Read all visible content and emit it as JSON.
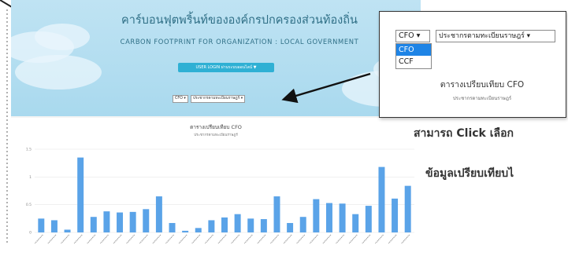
{
  "header": {
    "title_th": "คาร์บอนฟุตพริ้นท์ขององค์กรปกครองส่วนท้องถิ่น",
    "title_en": "CARBON FOOTPRINT FOR ORGANIZATION : LOCAL GOVERNMENT",
    "user_button": "USER LOGIN ผ่านระบบออนไลน์ ▼"
  },
  "filters": {
    "metric": "CFO ▾",
    "basis": "ประชากรตามทะเบียนราษฎร์ ▾"
  },
  "chart_data": {
    "type": "bar",
    "title": "ตารางเปรียบเทียบ CFO",
    "subtitle": "ประชากรตามทะเบียนราษฎร์",
    "ylim": [
      0,
      1.5
    ],
    "yticks": [
      0,
      0.5,
      1,
      1.5
    ],
    "values": [
      0.25,
      0.22,
      0.05,
      1.35,
      0.28,
      0.38,
      0.36,
      0.37,
      0.42,
      0.65,
      0.17,
      0.03,
      0.08,
      0.22,
      0.27,
      0.33,
      0.25,
      0.24,
      0.65,
      0.17,
      0.28,
      0.6,
      0.53,
      0.52,
      0.33,
      0.48,
      1.18,
      0.61,
      0.84
    ],
    "bar_color": "#5aa3e8"
  },
  "zoom": {
    "select_metric": "CFO ▾",
    "select_basis": "ประชากรตามทะเบียนราษฎร์ ▾",
    "options": [
      "CFO",
      "CCF"
    ],
    "selected": "CFO",
    "chart_title": "ตารางเปรียบเทียบ CFO",
    "chart_subtitle": "ประชากรตามทะเบียนราษฎร์"
  },
  "notes": {
    "line1": "สามารถ Click เลือก",
    "line2": "ข้อมูลเปรียบเทียบไ"
  }
}
